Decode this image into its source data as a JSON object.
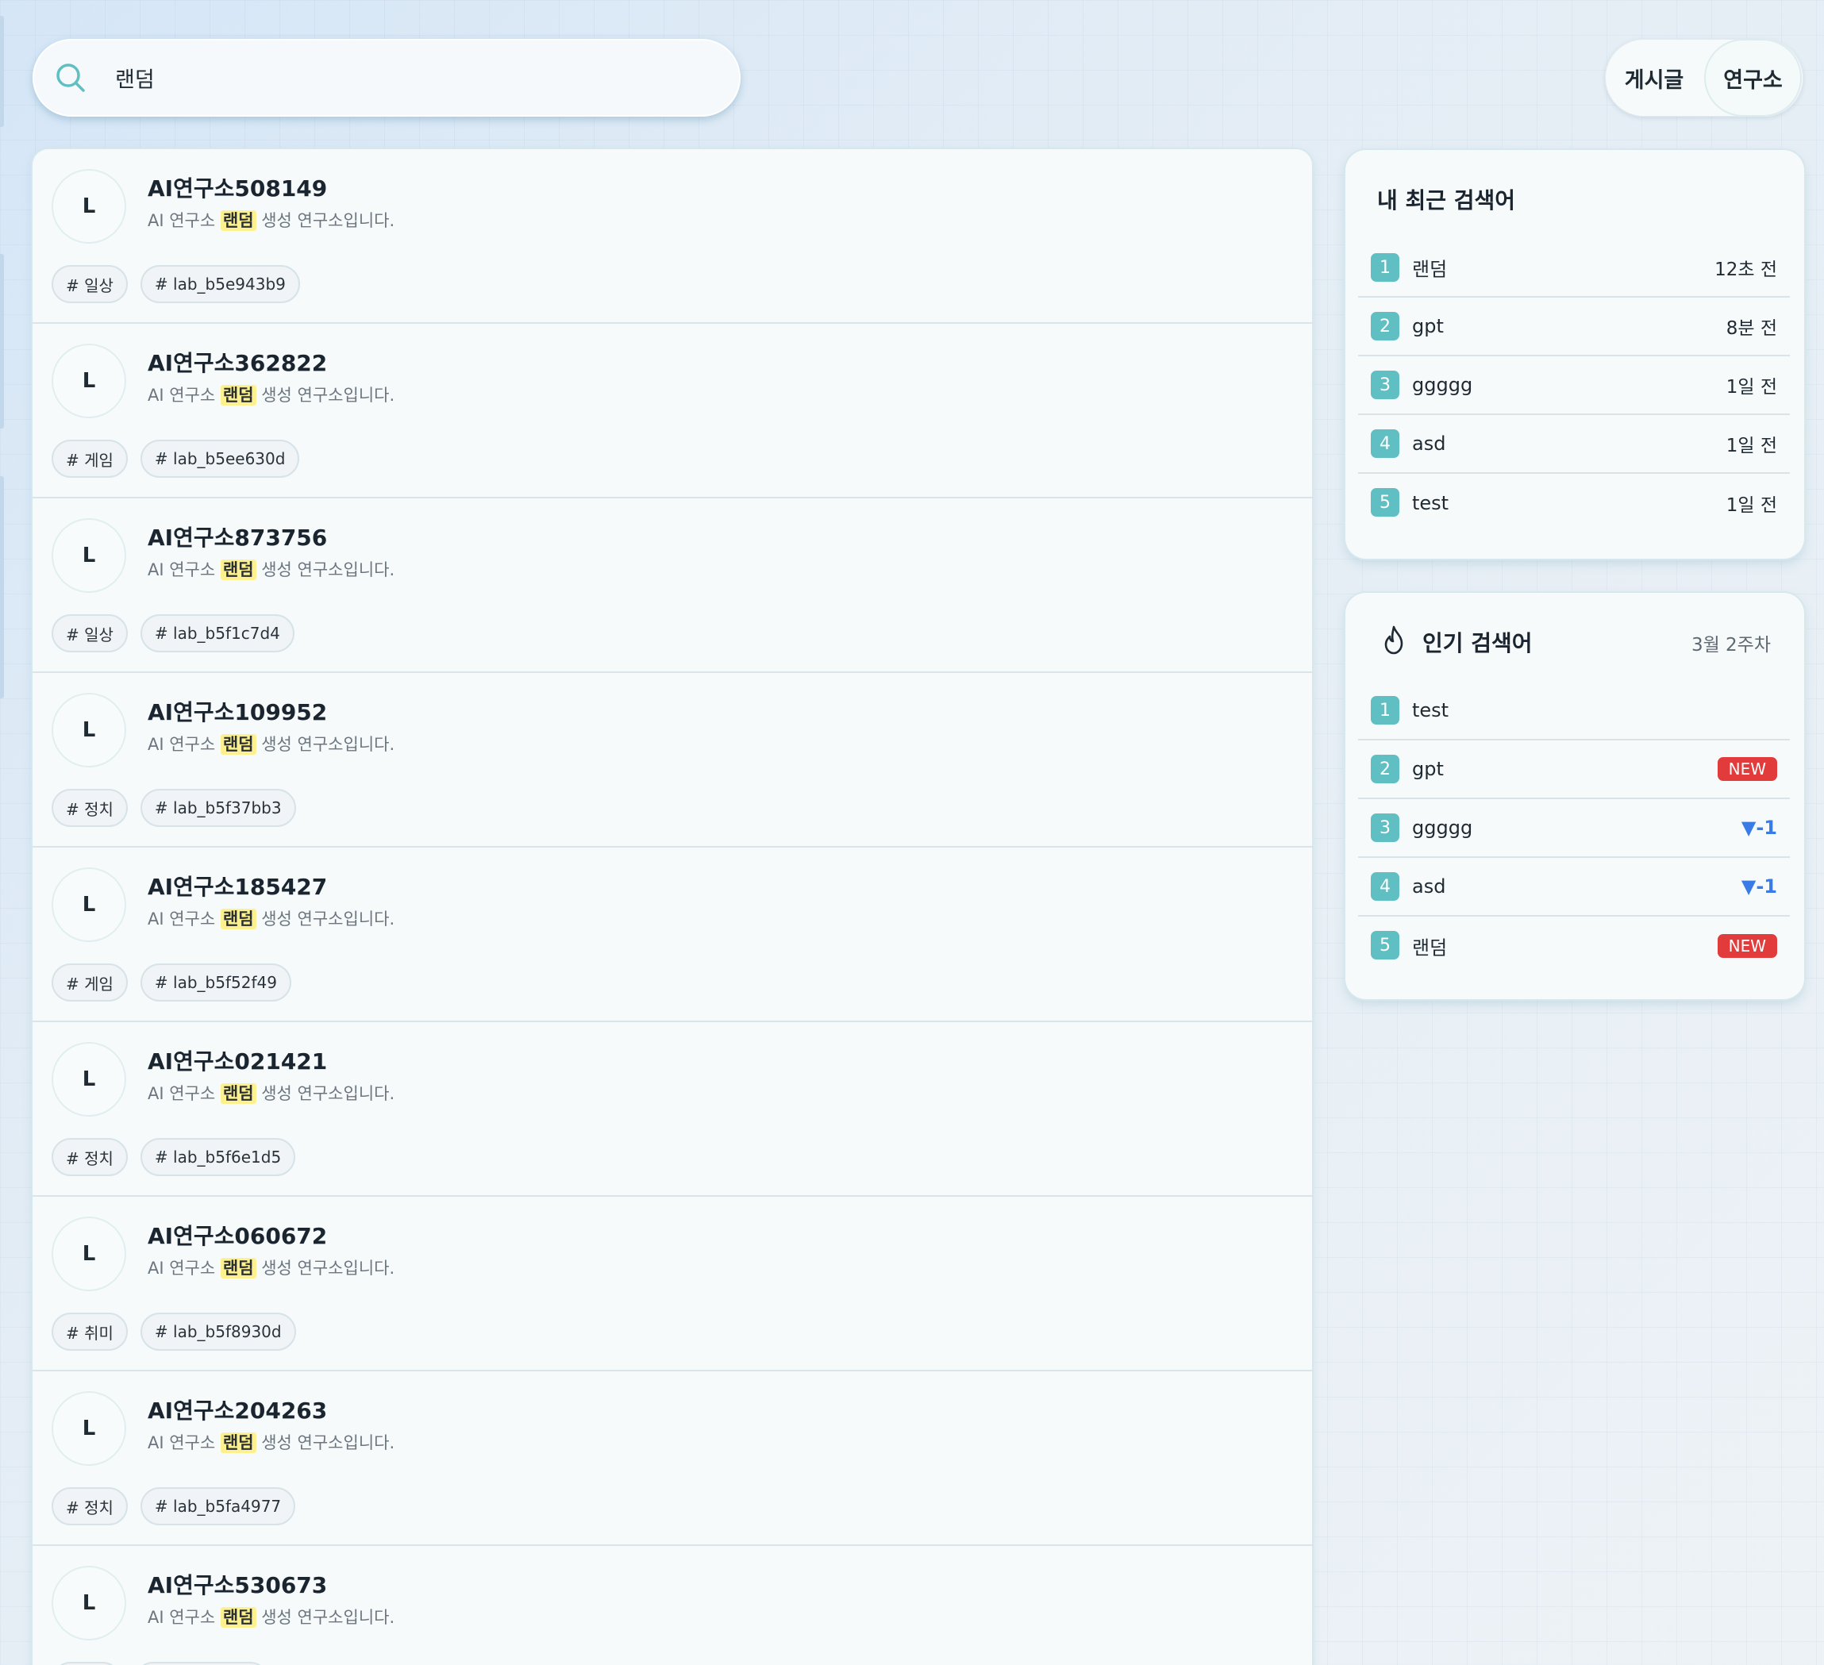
{
  "search": {
    "query": "랜덤"
  },
  "type_toggle": {
    "post_label": "게시글",
    "lab_label": "연구소",
    "active": "연구소"
  },
  "results": [
    {
      "avatar_letter": "L",
      "name": "AI연구소508149",
      "desc_before": "AI 연구소",
      "highlight": "랜덤",
      "desc_after": "생성 연구소입니다.",
      "tags": [
        "# 일상",
        "# lab_b5e943b9"
      ]
    },
    {
      "avatar_letter": "L",
      "name": "AI연구소362822",
      "desc_before": "AI 연구소",
      "highlight": "랜덤",
      "desc_after": "생성 연구소입니다.",
      "tags": [
        "# 게임",
        "# lab_b5ee630d"
      ]
    },
    {
      "avatar_letter": "L",
      "name": "AI연구소873756",
      "desc_before": "AI 연구소",
      "highlight": "랜덤",
      "desc_after": "생성 연구소입니다.",
      "tags": [
        "# 일상",
        "# lab_b5f1c7d4"
      ]
    },
    {
      "avatar_letter": "L",
      "name": "AI연구소109952",
      "desc_before": "AI 연구소",
      "highlight": "랜덤",
      "desc_after": "생성 연구소입니다.",
      "tags": [
        "# 정치",
        "# lab_b5f37bb3"
      ]
    },
    {
      "avatar_letter": "L",
      "name": "AI연구소185427",
      "desc_before": "AI 연구소",
      "highlight": "랜덤",
      "desc_after": "생성 연구소입니다.",
      "tags": [
        "# 게임",
        "# lab_b5f52f49"
      ]
    },
    {
      "avatar_letter": "L",
      "name": "AI연구소021421",
      "desc_before": "AI 연구소",
      "highlight": "랜덤",
      "desc_after": "생성 연구소입니다.",
      "tags": [
        "# 정치",
        "# lab_b5f6e1d5"
      ]
    },
    {
      "avatar_letter": "L",
      "name": "AI연구소060672",
      "desc_before": "AI 연구소",
      "highlight": "랜덤",
      "desc_after": "생성 연구소입니다.",
      "tags": [
        "# 취미",
        "# lab_b5f8930d"
      ]
    },
    {
      "avatar_letter": "L",
      "name": "AI연구소204263",
      "desc_before": "AI 연구소",
      "highlight": "랜덤",
      "desc_after": "생성 연구소입니다.",
      "tags": [
        "# 정치",
        "# lab_b5fa4977"
      ]
    },
    {
      "avatar_letter": "L",
      "name": "AI연구소530673",
      "desc_before": "AI 연구소",
      "highlight": "랜덤",
      "desc_after": "생성 연구소입니다.",
      "tags": [
        "",
        ""
      ]
    }
  ],
  "recent": {
    "title": "내 최근 검색어",
    "items": [
      {
        "rank": "1",
        "keyword": "랜덤",
        "time": "12초 전"
      },
      {
        "rank": "2",
        "keyword": "gpt",
        "time": "8분 전"
      },
      {
        "rank": "3",
        "keyword": "ggggg",
        "time": "1일 전"
      },
      {
        "rank": "4",
        "keyword": "asd",
        "time": "1일 전"
      },
      {
        "rank": "5",
        "keyword": "test",
        "time": "1일 전"
      }
    ]
  },
  "popular": {
    "title": "인기 검색어",
    "icon": "fire-icon",
    "week": "3월 2주차",
    "items": [
      {
        "rank": "1",
        "keyword": "test",
        "badge": "",
        "change": ""
      },
      {
        "rank": "2",
        "keyword": "gpt",
        "badge": "NEW",
        "change": ""
      },
      {
        "rank": "3",
        "keyword": "ggggg",
        "badge": "",
        "change": "▼-1"
      },
      {
        "rank": "4",
        "keyword": "asd",
        "badge": "",
        "change": "▼-1"
      },
      {
        "rank": "5",
        "keyword": "랜덤",
        "badge": "NEW",
        "change": ""
      }
    ]
  },
  "colors": {
    "accent": "#5fbfc2",
    "new_badge": "#e23b3b",
    "rank_down": "#3b7be6",
    "highlight": "#fdf18f"
  }
}
